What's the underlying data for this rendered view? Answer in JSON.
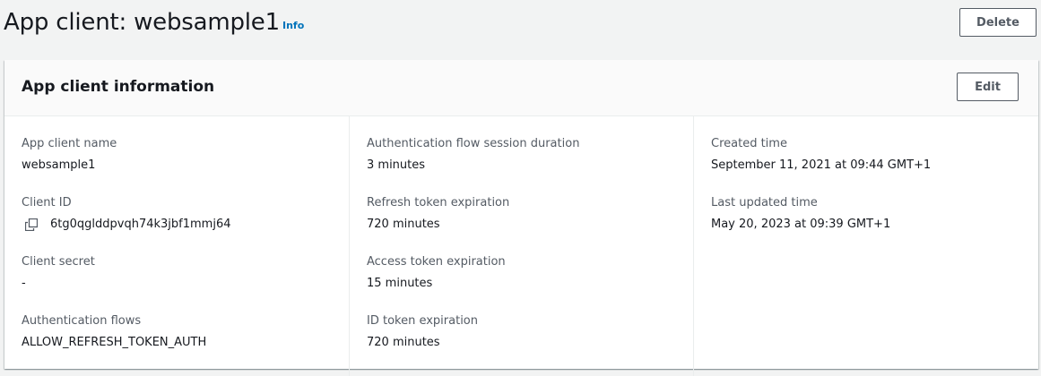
{
  "header": {
    "title": "App client: websample1",
    "info_label": "Info",
    "delete_label": "Delete"
  },
  "panel": {
    "title": "App client information",
    "edit_label": "Edit"
  },
  "fields": {
    "app_client_name": {
      "label": "App client name",
      "value": "websample1"
    },
    "client_id": {
      "label": "Client ID",
      "value": "6tg0qglddpvqh74k3jbf1mmj64"
    },
    "client_secret": {
      "label": "Client secret",
      "value": "-"
    },
    "auth_flows": {
      "label": "Authentication flows",
      "value": "ALLOW_REFRESH_TOKEN_AUTH"
    },
    "session_duration": {
      "label": "Authentication flow session duration",
      "value": "3 minutes"
    },
    "refresh_token": {
      "label": "Refresh token expiration",
      "value": "720 minutes"
    },
    "access_token": {
      "label": "Access token expiration",
      "value": "15 minutes"
    },
    "id_token": {
      "label": "ID token expiration",
      "value": "720 minutes"
    },
    "created_time": {
      "label": "Created time",
      "value": "September 11, 2021 at 09:44 GMT+1"
    },
    "last_updated": {
      "label": "Last updated time",
      "value": "May 20, 2023 at 09:39 GMT+1"
    }
  },
  "icons": {
    "copy": "copy-icon"
  },
  "colors": {
    "link": "#0073bb",
    "text": "#16191f",
    "label": "#545b64",
    "background": "#f2f3f3"
  }
}
